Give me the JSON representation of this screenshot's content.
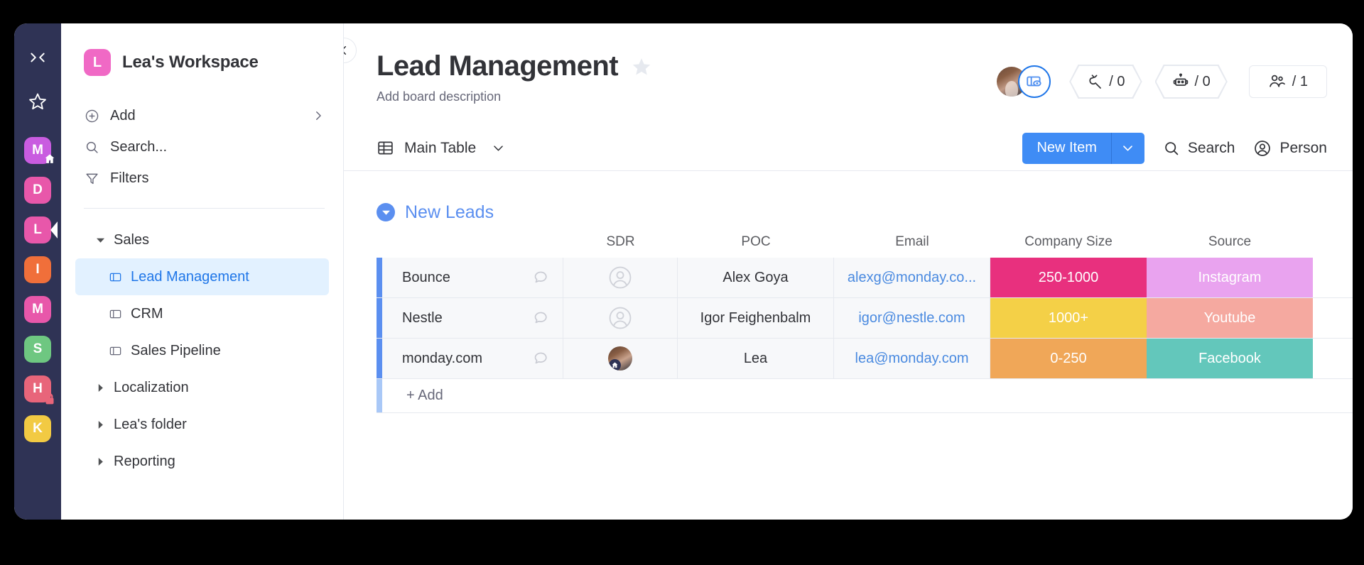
{
  "rail": {
    "collapse_icon": "collapse-panel-icon",
    "favorites_icon": "star-icon",
    "tiles": [
      {
        "letter": "M",
        "color": "#c95ce0",
        "badge": "home"
      },
      {
        "letter": "D",
        "color": "#e857aa"
      },
      {
        "letter": "L",
        "color": "#e857aa",
        "active": true
      },
      {
        "letter": "I",
        "color": "#f06f3a"
      },
      {
        "letter": "M",
        "color": "#e857aa"
      },
      {
        "letter": "S",
        "color": "#6ec781"
      },
      {
        "letter": "H",
        "color": "#e8657a",
        "badge": "lock"
      },
      {
        "letter": "K",
        "color": "#f2ca43"
      }
    ]
  },
  "sidebar": {
    "workspace_initial": "L",
    "workspace_name": "Lea's Workspace",
    "add_label": "Add",
    "search_label": "Search...",
    "filters_label": "Filters",
    "tree": [
      {
        "label": "Sales",
        "type": "folder",
        "expanded": true
      },
      {
        "label": "Lead Management",
        "type": "board",
        "selected": true
      },
      {
        "label": "CRM",
        "type": "board"
      },
      {
        "label": "Sales Pipeline",
        "type": "board"
      },
      {
        "label": "Localization",
        "type": "folder",
        "expanded": false
      },
      {
        "label": "Lea's folder",
        "type": "folder",
        "expanded": false
      },
      {
        "label": "Reporting",
        "type": "folder",
        "expanded": false
      }
    ]
  },
  "board": {
    "title": "Lead Management",
    "description": "Add board description",
    "favorite_icon": "star-icon",
    "integrations_count": "/ 0",
    "automations_count": "/ 0",
    "members_count": "/ 1"
  },
  "toolbar": {
    "view_label": "Main Table",
    "new_item_label": "New Item",
    "search_label": "Search",
    "person_label": "Person"
  },
  "table": {
    "group_name": "New Leads",
    "columns": [
      "",
      "SDR",
      "POC",
      "Email",
      "Company Size",
      "Source"
    ],
    "add_row_label": "+ Add",
    "rows": [
      {
        "name": "Bounce",
        "sdr": "",
        "poc": "Alex Goya",
        "email": "alexg@monday.co...",
        "company_size": "250-1000",
        "company_size_color": "#e8307e",
        "source": "Instagram",
        "source_color": "#e9a3ef"
      },
      {
        "name": "Nestle",
        "sdr": "",
        "poc": "Igor Feighenbalm",
        "email": "igor@nestle.com",
        "company_size": "1000+",
        "company_size_color": "#f4d047",
        "source": "Youtube",
        "source_color": "#f5a9a0"
      },
      {
        "name": "monday.com",
        "sdr": "lea-avatar",
        "poc": "Lea",
        "email": "lea@monday.com",
        "company_size": "0-250",
        "company_size_color": "#f0a758",
        "source": "Facebook",
        "source_color": "#63c7bb"
      }
    ]
  }
}
